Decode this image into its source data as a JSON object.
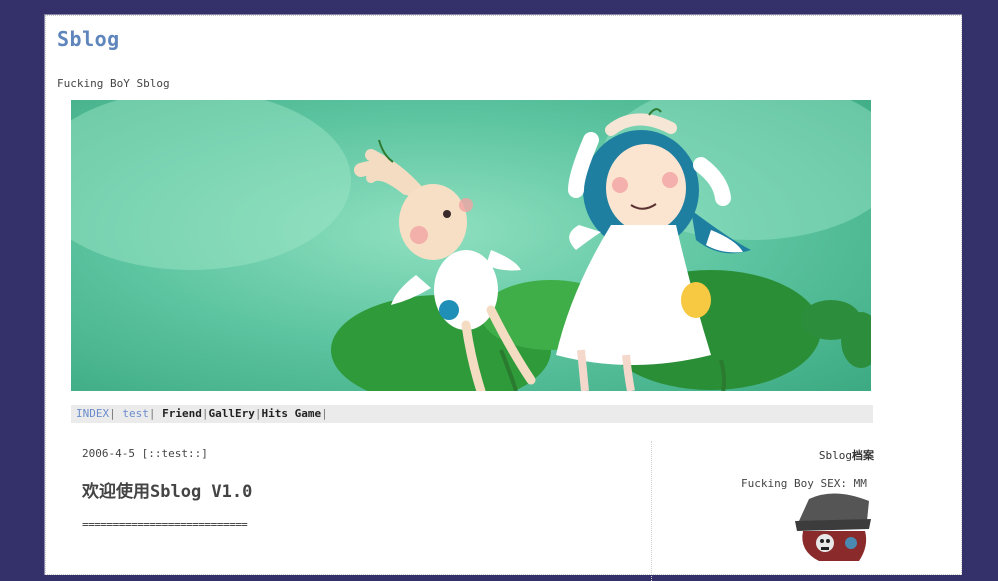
{
  "site": {
    "title": "Sblog",
    "subtitle": "Fucking BoY Sblog"
  },
  "nav": {
    "items": [
      {
        "label": "INDEX",
        "style": "light"
      },
      {
        "label": "test",
        "style": "light"
      },
      {
        "label": "Friend",
        "style": "bold"
      },
      {
        "label": "GallEry",
        "style": "bold"
      },
      {
        "label": "Hits Game",
        "style": "bold"
      }
    ],
    "separator": "|"
  },
  "post": {
    "meta": "2006-4-5 [::test::]",
    "title": "欢迎使用Sblog V1.0",
    "rule": "==========================="
  },
  "sidebar": {
    "title_prefix": "Sblog",
    "title_suffix": "档案",
    "info": "Fucking Boy SEX: MM"
  },
  "colors": {
    "background": "#34306a",
    "title": "#5f85bd",
    "nav_bg": "#ebebeb",
    "nav_light_link": "#6b8ccc"
  },
  "icons": {
    "banner": "illustration-girl-and-bunny",
    "avatar": "skull-cap-avatar"
  }
}
